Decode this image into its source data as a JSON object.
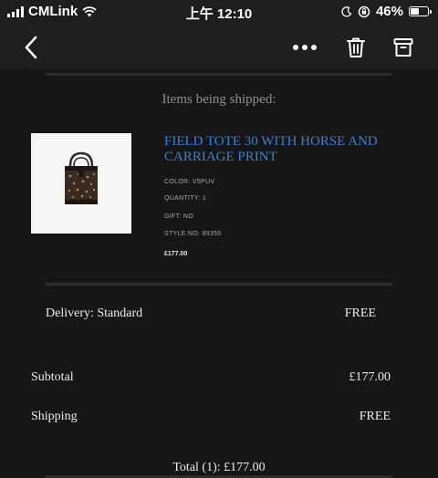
{
  "status_bar": {
    "carrier": "CMLink",
    "time": "上午 12:10",
    "battery_percent": "46%",
    "battery_level": 0.46
  },
  "toolbar": {
    "icons": [
      "back-arrow-icon",
      "more-icon",
      "trash-icon",
      "archive-icon"
    ]
  },
  "shipment": {
    "section_title": "Items being shipped:",
    "product": {
      "name": "FIELD TOTE 30 WITH HORSE AND CARRIAGE PRINT",
      "color": "COLOR: V5PUV",
      "quantity": "QUANTITY: 1",
      "gift": "GIFT: NO",
      "style_no": "STYLE NO: 89355",
      "price": "£177.00"
    }
  },
  "delivery": {
    "label": "Delivery: Standard",
    "value": "FREE"
  },
  "totals": {
    "subtotal_label": "Subtotal",
    "subtotal_value": "£177.00",
    "shipping_label": "Shipping",
    "shipping_value": "FREE",
    "total_line": "Total (1): £177.00"
  },
  "colors": {
    "background": "#161616",
    "link_blue": "#3b7fd8"
  }
}
